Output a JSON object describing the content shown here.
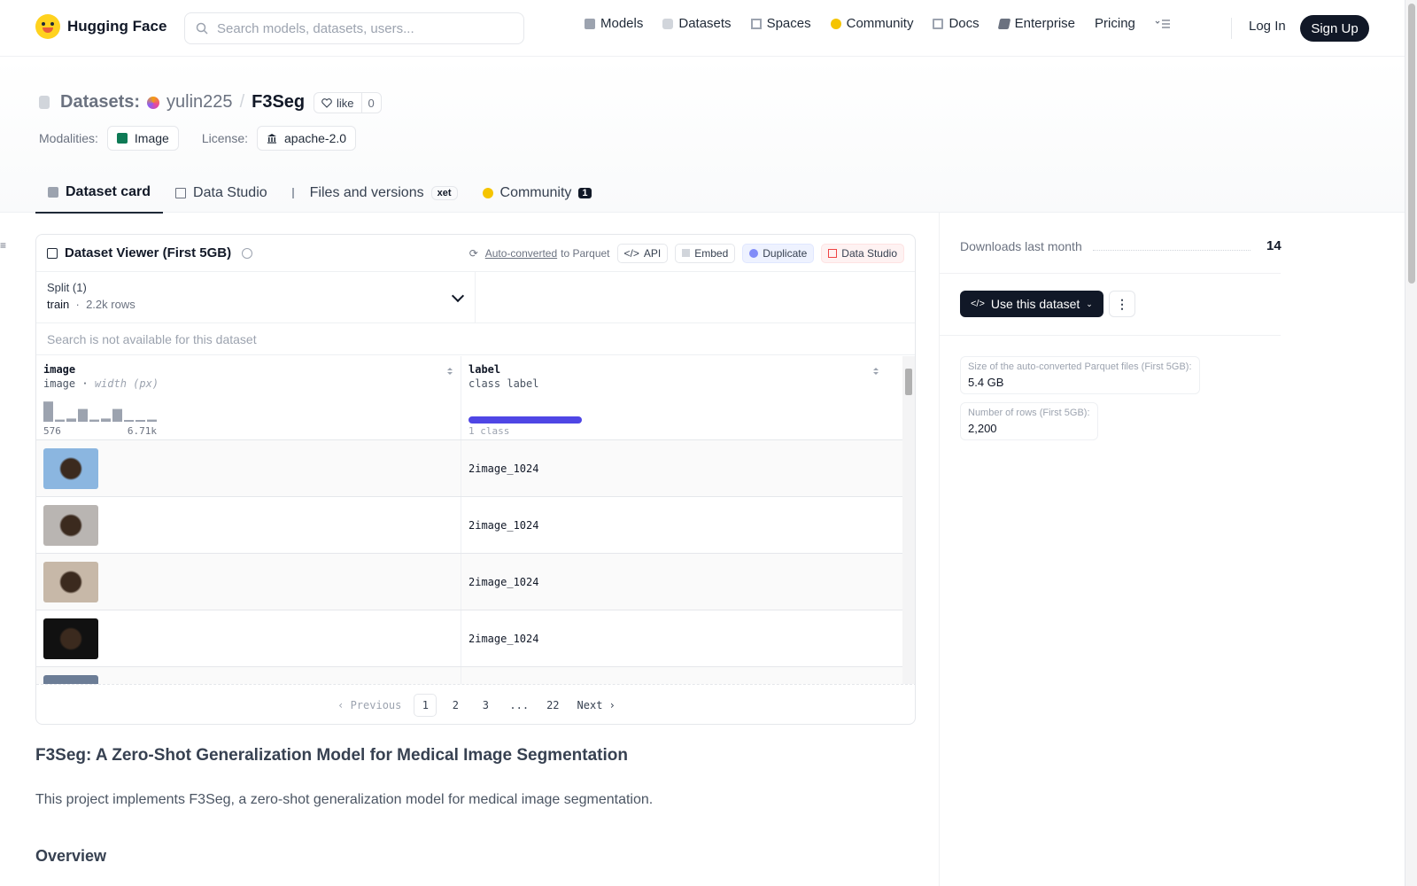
{
  "nav": {
    "brand": "Hugging Face",
    "search_placeholder": "Search models, datasets, users...",
    "links": [
      {
        "label": "Models",
        "icon": "models-icon",
        "color": "#9ca3af"
      },
      {
        "label": "Datasets",
        "icon": "datasets-icon",
        "color": "#d1d5db"
      },
      {
        "label": "Spaces",
        "icon": "spaces-icon",
        "color": "#9ca3af"
      },
      {
        "label": "Community",
        "icon": "community-icon",
        "color": "#f5c400"
      },
      {
        "label": "Docs",
        "icon": "docs-icon",
        "color": "#9ca3af"
      },
      {
        "label": "Enterprise",
        "icon": "enterprise-icon",
        "color": "#6b7280"
      },
      {
        "label": "Pricing",
        "icon": "",
        "color": ""
      }
    ],
    "login": "Log In",
    "signup": "Sign Up"
  },
  "header": {
    "section": "Datasets:",
    "owner": "yulin225",
    "name": "F3Seg",
    "like_label": "like",
    "like_count": "0",
    "modalities_label": "Modalities:",
    "modality": "Image",
    "license_label": "License:",
    "license": "apache-2.0"
  },
  "tabs": [
    {
      "label": "Dataset card",
      "active": true
    },
    {
      "label": "Data Studio",
      "active": false
    },
    {
      "label": "Files and versions",
      "badge": "xet",
      "active": false
    },
    {
      "label": "Community",
      "badge": "1",
      "active": false
    }
  ],
  "viewer": {
    "title": "Dataset Viewer (First 5GB)",
    "auto_converted": "Auto-converted",
    "to_parquet": "to Parquet",
    "api": "API",
    "embed": "Embed",
    "duplicate": "Duplicate",
    "data_studio": "Data Studio",
    "split_label": "Split (1)",
    "split_name": "train",
    "split_rows": "2.2k rows",
    "search_disabled": "Search is not available for this dataset",
    "columns": [
      {
        "name": "image",
        "type": "image",
        "subtype": "width (px)",
        "hist_min": "576",
        "hist_max": "6.71k"
      },
      {
        "name": "label",
        "type": "class label",
        "summary": "1 class"
      }
    ],
    "histogram": [
      0.95,
      0.1,
      0.15,
      0.6,
      0.1,
      0.15,
      0.6,
      0.05,
      0.0,
      0.1
    ],
    "rows": [
      {
        "thumb": "#8bb6e0",
        "label_value": "2",
        "label_name": "image_1024"
      },
      {
        "thumb": "#b9b5b2",
        "label_value": "2",
        "label_name": "image_1024"
      },
      {
        "thumb": "#c7b8a8",
        "label_value": "2",
        "label_name": "image_1024"
      },
      {
        "thumb": "#111111",
        "label_value": "2",
        "label_name": "image_1024"
      },
      {
        "thumb": "#6c7d96",
        "label_value": "",
        "label_name": ""
      }
    ],
    "pager": {
      "prev": "Previous",
      "pages": [
        "1",
        "2",
        "3",
        "...",
        "22"
      ],
      "next": "Next",
      "current": "1"
    }
  },
  "readme": {
    "title": "F3Seg: A Zero-Shot Generalization Model for Medical Image Segmentation",
    "intro": "This project implements F3Seg, a zero-shot generalization model for medical image segmentation.",
    "overview": "Overview"
  },
  "sidebar": {
    "downloads_label": "Downloads last month",
    "downloads_value": "14",
    "use_button": "Use this dataset",
    "stats": [
      {
        "label": "Size of the auto-converted Parquet files (First 5GB):",
        "value": "5.4 GB"
      },
      {
        "label": "Number of rows (First 5GB):",
        "value": "2,200"
      }
    ]
  }
}
